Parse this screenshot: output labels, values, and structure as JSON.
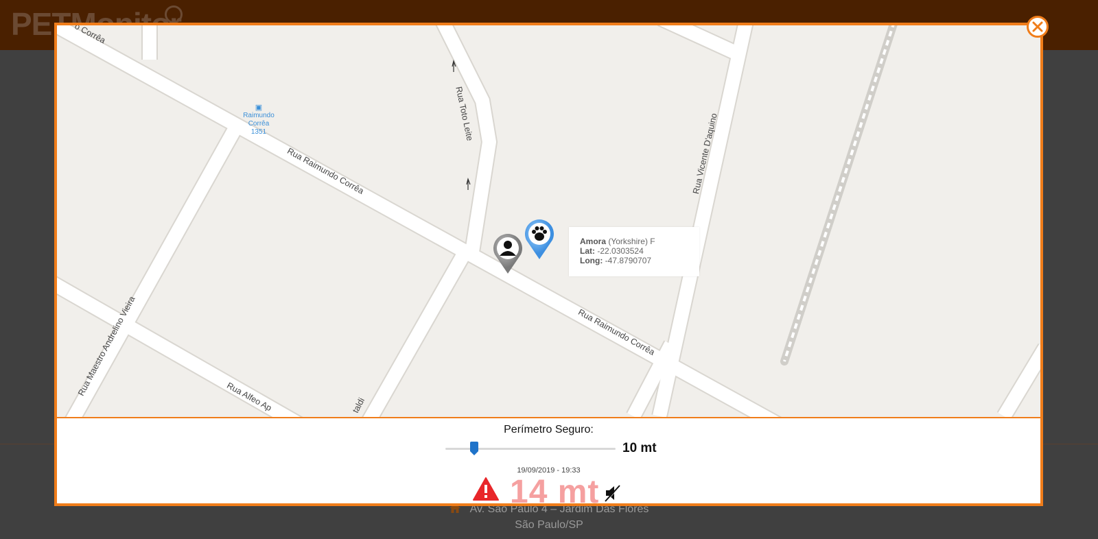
{
  "app": {
    "logo_text": "PETMonitor"
  },
  "background_page": {
    "address_line1": "Av. São Paulo 4 – Jardim Das Flores",
    "address_line2": "São Paulo/SP"
  },
  "map": {
    "streets": [
      "Rua Raimundo Corrêa",
      "Rua Raimundo Corrêa",
      "Rua Toto Leite",
      "Rua Vicente D'aquino",
      "Rua Maestro Andrelino Vieira",
      "Rua Alfeo Ap",
      "taldi",
      "o Corrêa"
    ],
    "bus_stop": {
      "line1": "Raimundo",
      "line2": "Corrêa",
      "line3": "1351"
    },
    "pet_info": {
      "name": "Amora",
      "breed": "(Yorkshire) F",
      "lat_label": "Lat:",
      "lat_value": "-22.0303524",
      "long_label": "Long:",
      "long_value": "-47.8790707"
    },
    "markers": {
      "owner_icon": "person-icon",
      "pet_icon": "paw-icon"
    }
  },
  "panel": {
    "perimeter_title": "Perímetro Seguro:",
    "perimeter_value": "10 mt",
    "slider_level": 0.17,
    "timestamp": "19/09/2019 - 19:33",
    "distance": "14 mt",
    "alert_icon": "warning-icon",
    "sound_icon": "sound-muted-icon"
  },
  "colors": {
    "accent": "#f07d1a",
    "alert": "#e8262a",
    "distance": "#f5a0a0",
    "slider": "#1f73c9",
    "header": "#4a2000"
  }
}
